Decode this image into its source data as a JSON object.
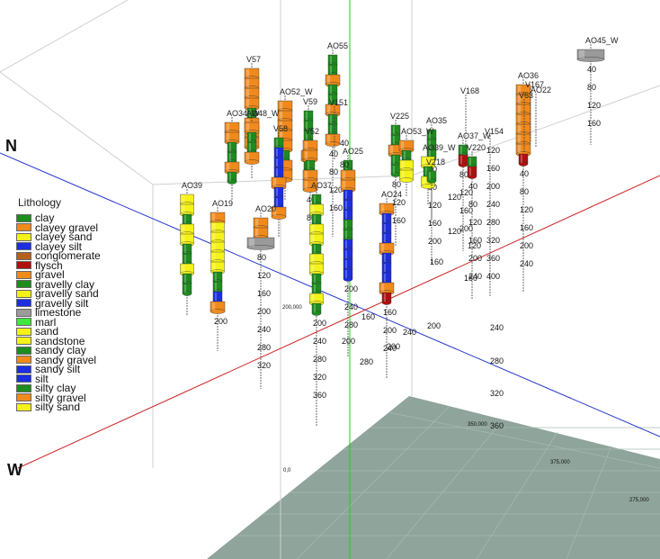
{
  "axes": {
    "north": "N",
    "west": "W"
  },
  "legend": {
    "title": "Lithology",
    "items": [
      {
        "key": "clay",
        "label": "clay",
        "color": "#1e8c1e"
      },
      {
        "key": "clayey_gravel",
        "label": "clayey gravel",
        "color": "#f08a1c"
      },
      {
        "key": "clayey_sand",
        "label": "clayey sand",
        "color": "#f5f21a"
      },
      {
        "key": "clayey_silt",
        "label": "clayey silt",
        "color": "#1c2ee0"
      },
      {
        "key": "conglomerate",
        "label": "conglomerate",
        "color": "#b5601c"
      },
      {
        "key": "flysch",
        "label": "flysch",
        "color": "#b01010"
      },
      {
        "key": "gravel",
        "label": "gravel",
        "color": "#f08a1c"
      },
      {
        "key": "gravelly_clay",
        "label": "gravelly clay",
        "color": "#1e8c1e"
      },
      {
        "key": "gravelly_sand",
        "label": "gravelly sand",
        "color": "#f5f21a"
      },
      {
        "key": "gravelly_silt",
        "label": "gravelly silt",
        "color": "#1c2ee0"
      },
      {
        "key": "limestone",
        "label": "limestone",
        "color": "#9a9a9a"
      },
      {
        "key": "marl",
        "label": "marl",
        "color": "#3ee83e"
      },
      {
        "key": "sand",
        "label": "sand",
        "color": "#f5f21a"
      },
      {
        "key": "sandstone",
        "label": "sandstone",
        "color": "#f5f21a"
      },
      {
        "key": "sandy_clay",
        "label": "sandy clay",
        "color": "#1e8c1e"
      },
      {
        "key": "sandy_gravel",
        "label": "sandy gravel",
        "color": "#f08a1c"
      },
      {
        "key": "sandy_silt",
        "label": "sandy silt",
        "color": "#1c2ee0"
      },
      {
        "key": "silt",
        "label": "silt",
        "color": "#1c2ee0"
      },
      {
        "key": "silty_clay",
        "label": "silty clay",
        "color": "#1e8c1e"
      },
      {
        "key": "silty_gravel",
        "label": "silty gravel",
        "color": "#f08a1c"
      },
      {
        "key": "silty_sand",
        "label": "silty sand",
        "color": "#f5f21a"
      }
    ]
  },
  "boreholes": [
    {
      "name": "AO55",
      "pattern": [
        "clay",
        "clay",
        "gravel",
        "clay",
        "clay",
        "gravel",
        "clay",
        "clay",
        "gravel"
      ],
      "depth_ticks": [
        "40",
        "80",
        "120",
        "160"
      ]
    },
    {
      "name": "V57",
      "pattern": [
        "gravel",
        "gravel",
        "gravel",
        "gravel",
        "clay",
        "gravel",
        "gravel",
        "gravel"
      ],
      "depth_ticks": []
    },
    {
      "name": "AO52_W",
      "pattern": [
        "gravel",
        "gravel",
        "gravel",
        "gravel",
        "gravel",
        "clay",
        "gravel",
        "gravel"
      ],
      "depth_ticks": []
    },
    {
      "name": "V59",
      "pattern": [
        "clay",
        "clay",
        "clay",
        "clay",
        "gravel",
        "clay"
      ],
      "depth_ticks": []
    },
    {
      "name": "V151",
      "pattern": [],
      "depth_ticks": []
    },
    {
      "name": "AO34_W",
      "pattern": [
        "gravel",
        "gravel",
        "clay",
        "clay",
        "gravel",
        "clay"
      ],
      "depth_ticks": []
    },
    {
      "name": "AO48_W",
      "pattern": [
        "gravel",
        "clay",
        "clay",
        "gravel"
      ],
      "depth_ticks": []
    },
    {
      "name": "V58",
      "pattern": [
        "clay",
        "silt",
        "silt",
        "silt",
        "gravel",
        "silt",
        "silt",
        "gravel"
      ],
      "depth_ticks": []
    },
    {
      "name": "V52",
      "pattern": [
        "gravel",
        "gravel",
        "clay",
        "gravel",
        "gravel"
      ],
      "depth_ticks": [
        "40",
        "80"
      ]
    },
    {
      "name": "AO39",
      "pattern": [
        "sand",
        "sand",
        "clay",
        "sand",
        "sand",
        "clay",
        "clay",
        "sand",
        "clay",
        "clay"
      ],
      "depth_ticks": []
    },
    {
      "name": "AO19",
      "pattern": [
        "gravel",
        "sand",
        "sand",
        "sand",
        "sand",
        "sand",
        "clay",
        "clay",
        "silt",
        "gravel"
      ],
      "depth_ticks": [
        "200"
      ]
    },
    {
      "name": "AO20",
      "pattern": [
        "gravel",
        "gravel",
        "limestone"
      ],
      "depth_ticks": [
        "80",
        "120",
        "160",
        "200",
        "240",
        "280",
        "320"
      ]
    },
    {
      "name": "AO37",
      "pattern": [
        "clay",
        "sand",
        "clay",
        "sand",
        "sand",
        "clay",
        "sand",
        "sand",
        "clay",
        "clay",
        "sand",
        "clay"
      ],
      "depth_ticks": [
        "200",
        "240",
        "280",
        "320",
        "360"
      ]
    },
    {
      "name": "AO25",
      "pattern": [
        "clay",
        "gravel",
        "gravel",
        "silt",
        "silt",
        "silt",
        "clay",
        "clay",
        "silt",
        "silt",
        "silt",
        "silt"
      ],
      "depth_ticks": [
        "200",
        "240",
        "280"
      ]
    },
    {
      "name": "AO24",
      "pattern": [
        "gravel",
        "silt",
        "silt",
        "silt",
        "gravel",
        "silt",
        "silt",
        "silt",
        "gravel",
        "flysch"
      ],
      "depth_ticks": [
        "160",
        "200",
        "240"
      ]
    },
    {
      "name": "V225",
      "pattern": [
        "clay",
        "clay",
        "gravel",
        "clay",
        "clay"
      ],
      "depth_ticks": [
        "80",
        "120",
        "160"
      ]
    },
    {
      "name": "AO35",
      "pattern": [
        "clay",
        "clay",
        "clay"
      ],
      "depth_ticks": [
        "40",
        "80",
        "120",
        "160",
        "200"
      ]
    },
    {
      "name": "AO53_W",
      "pattern": [
        "gravel",
        "clay",
        "sand",
        "sand"
      ],
      "depth_ticks": []
    },
    {
      "name": "AO39_W",
      "pattern": [
        "sand",
        "clay",
        "sand"
      ],
      "depth_ticks": []
    },
    {
      "name": "V218",
      "pattern": [
        "clay"
      ],
      "depth_ticks": []
    },
    {
      "name": "AO37_W",
      "pattern": [
        "clay",
        "flysch"
      ],
      "depth_ticks": [
        "80",
        "120",
        "160",
        "200"
      ]
    },
    {
      "name": "V168",
      "pattern": [],
      "depth_ticks": []
    },
    {
      "name": "V220",
      "pattern": [
        "clay",
        "flysch"
      ],
      "depth_ticks": [
        "40",
        "80",
        "120",
        "160",
        "200",
        "240"
      ]
    },
    {
      "name": "V154",
      "pattern": [],
      "depth_ticks": [
        "120",
        "160",
        "200",
        "240",
        "280",
        "320",
        "360",
        "400"
      ]
    },
    {
      "name": "AO36",
      "pattern": [
        "gravel",
        "gravel",
        "gravel",
        "gravel",
        "gravel",
        "gravel",
        "gravel",
        "flysch"
      ],
      "depth_ticks": [
        "40",
        "80",
        "120",
        "160",
        "200",
        "240"
      ]
    },
    {
      "name": "V167",
      "pattern": [],
      "depth_ticks": []
    },
    {
      "name": "AO22",
      "pattern": [],
      "depth_ticks": []
    },
    {
      "name": "V63",
      "pattern": [],
      "depth_ticks": []
    },
    {
      "name": "AO45_W",
      "pattern": [
        "limestone"
      ],
      "depth_ticks": [
        "40",
        "80",
        "120",
        "160"
      ]
    }
  ],
  "extra_depth_labels": [
    "120",
    "120",
    "160",
    "160",
    "160",
    "200",
    "200",
    "200",
    "240",
    "240",
    "280",
    "280",
    "320",
    "360",
    "40",
    "80",
    "120"
  ],
  "grid_coords": [
    "200,000",
    "350,000",
    "375,000",
    "275,000",
    "0,0"
  ]
}
